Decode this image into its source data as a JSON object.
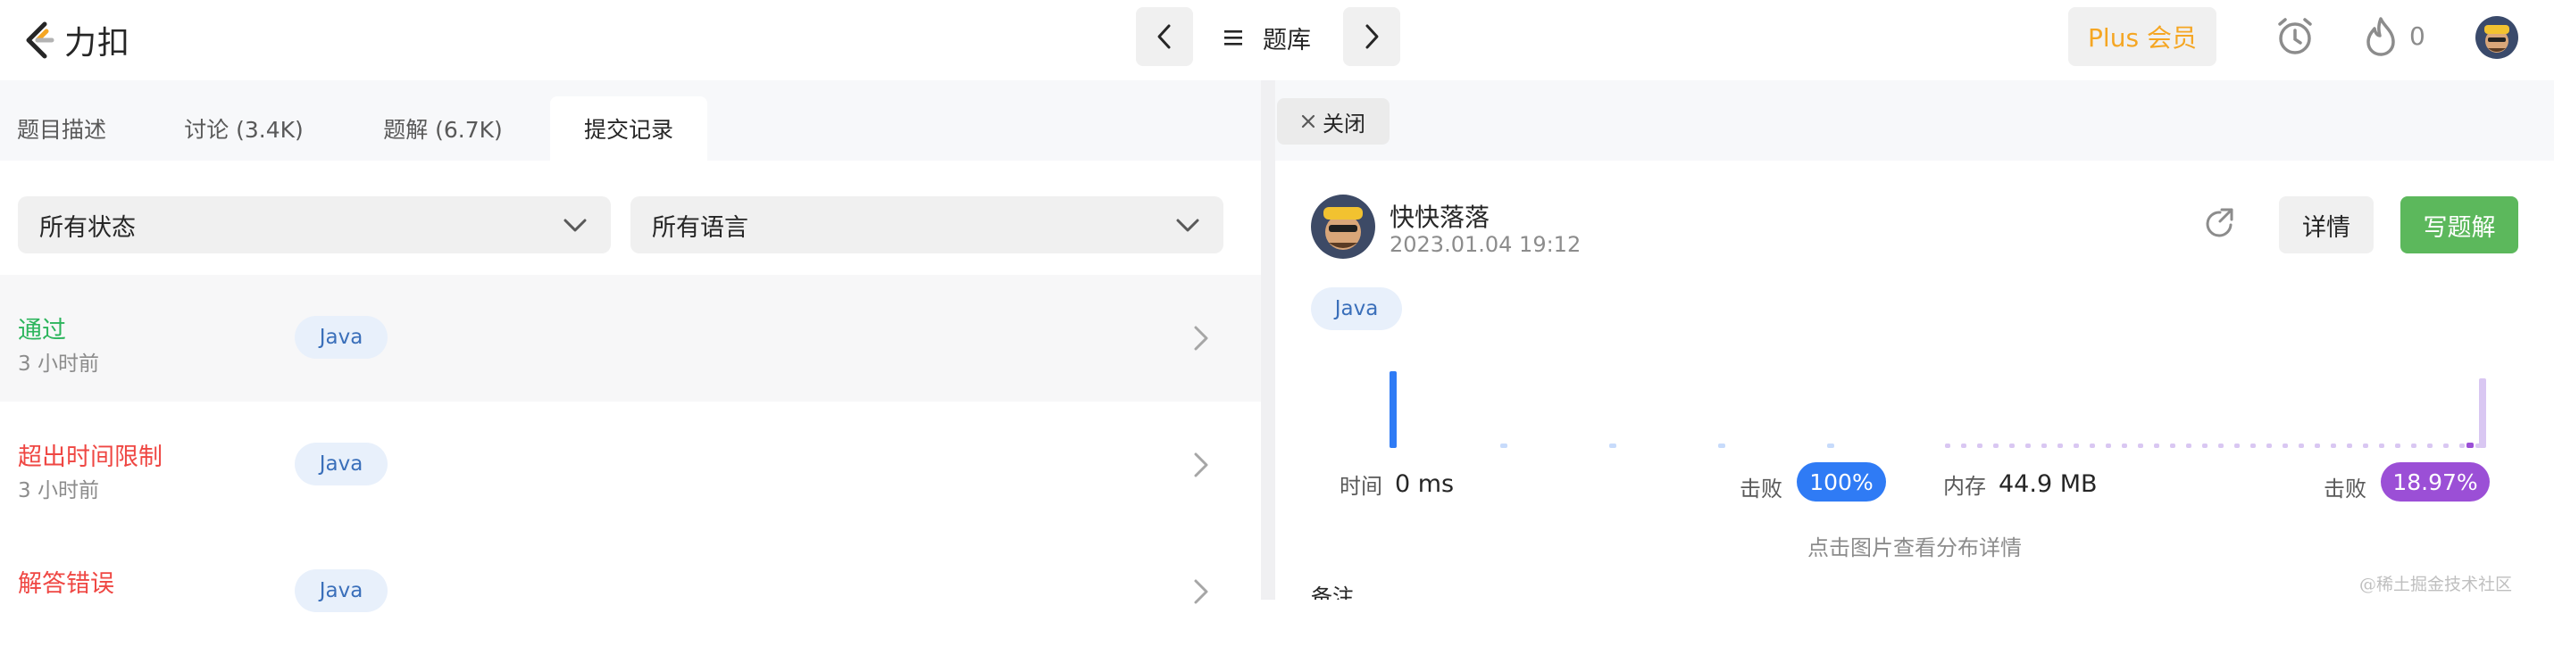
{
  "app": {
    "logo_text": "力扣",
    "problemset_label": "题库",
    "plus_label": "Plus 会员",
    "streak_count": "0"
  },
  "tabs": [
    {
      "label": "题目描述"
    },
    {
      "label": "讨论 (3.4K)"
    },
    {
      "label": "题解 (6.7K)"
    },
    {
      "label": "提交记录",
      "active": true
    }
  ],
  "filters": {
    "status_selected": "所有状态",
    "language_selected": "所有语言"
  },
  "submissions": [
    {
      "status": "通过",
      "status_color": "#2db55d",
      "time": "3 小时前",
      "lang": "Java"
    },
    {
      "status": "超出时间限制",
      "status_color": "#ef4743",
      "time": "3 小时前",
      "lang": "Java"
    },
    {
      "status": "解答错误",
      "status_color": "#ef4743",
      "time": "",
      "lang": "Java"
    }
  ],
  "detail": {
    "close_label": "关闭",
    "author": "快快落落",
    "datetime": "2023.01.04 19:12",
    "detail_button": "详情",
    "write_solution_button": "写题解",
    "language": "Java",
    "runtime_label": "时间",
    "runtime_value": "0 ms",
    "runtime_beat_label": "击败",
    "runtime_beat": "100%",
    "runtime_beat_color": "#2f7bf5",
    "memory_label": "内存",
    "memory_value": "44.9 MB",
    "memory_beat_label": "击败",
    "memory_beat": "18.97%",
    "memory_beat_color": "#9b4fd6",
    "hint": "点击图片查看分布详情",
    "note_label": "备注"
  },
  "watermark": "@稀土掘金技术社区",
  "colors": {
    "accent_orange": "#f5a623",
    "success_green": "#5cb85c",
    "runtime_bar": "#2f7bf5",
    "memory_bar": "#d9c7f2",
    "memory_highlight": "#9b4fd6"
  }
}
